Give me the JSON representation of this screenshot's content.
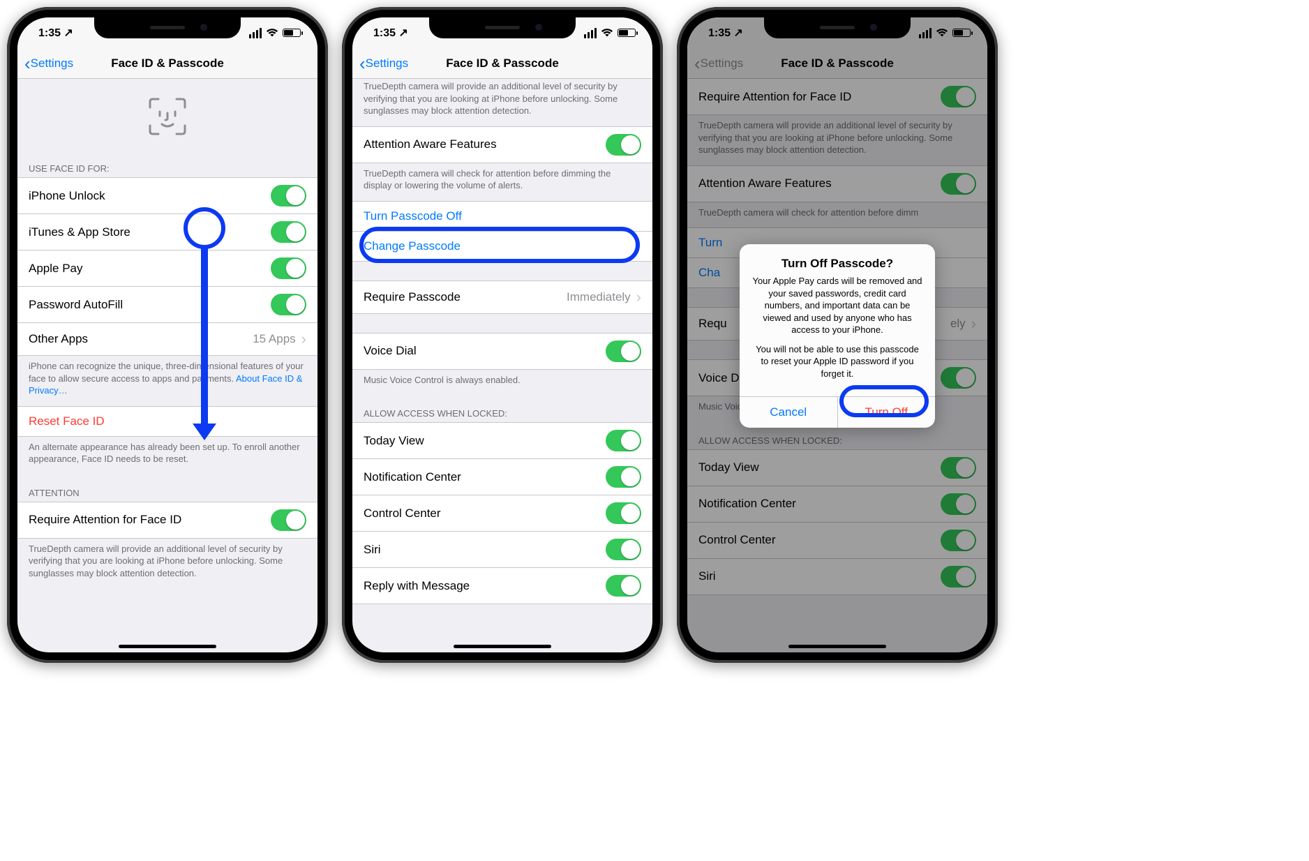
{
  "status": {
    "time": "1:35",
    "loc": "↗"
  },
  "nav": {
    "back": "Settings",
    "title": "Face ID & Passcode"
  },
  "s1": {
    "sectionHeader": "USE FACE ID FOR:",
    "rows": {
      "iphoneUnlock": "iPhone Unlock",
      "itunes": "iTunes & App Store",
      "applePay": "Apple Pay",
      "autofill": "Password AutoFill",
      "otherApps": "Other Apps",
      "otherAppsDetail": "15 Apps"
    },
    "footer1": "iPhone can recognize the unique, three-dimensional features of your face to allow secure access to apps and payments. ",
    "footer1Link": "About Face ID & Privacy…",
    "resetFaceId": "Reset Face ID",
    "footer2": "An alternate appearance has already been set up. To enroll another appearance, Face ID needs to be reset.",
    "attentionHdr": "ATTENTION",
    "reqAttention": "Require Attention for Face ID",
    "footer3": "TrueDepth camera will provide an additional level of security by verifying that you are looking at iPhone before unlocking. Some sunglasses may block attention detection."
  },
  "s2": {
    "truedepthPartial": "TrueDepth camera will provide an additional level of security by verifying that you are looking at iPhone before unlocking. Some sunglasses may block attention detection.",
    "attnAware": "Attention Aware Features",
    "attnFooter": "TrueDepth camera will check for attention before dimming the display or lowering the volume of alerts.",
    "turnOff": "Turn Passcode Off",
    "change": "Change Passcode",
    "reqPass": "Require Passcode",
    "reqPassVal": "Immediately",
    "voiceDial": "Voice Dial",
    "voiceFooter": "Music Voice Control is always enabled.",
    "allowHdr": "ALLOW ACCESS WHEN LOCKED:",
    "today": "Today View",
    "notif": "Notification Center",
    "control": "Control Center",
    "siri": "Siri",
    "reply": "Reply with Message"
  },
  "s3": {
    "reqAttention": "Require Attention for Face ID",
    "truedepthFooter": "TrueDepth camera will provide an additional level of security by verifying that you are looking at iPhone before unlocking. Some sunglasses may block attention detection.",
    "attnAware": "Attention Aware Features",
    "attnFooterPartial": "TrueDepth camera will check for attention before dimm",
    "turnTrunc": "Turn",
    "chaTrunc": "Cha",
    "reqPassTrunc": "Requ",
    "reqPassValTrunc": "ely",
    "voiceDial": "Voice Dial",
    "voiceFooter": "Music Voice Control is always enabled.",
    "allowHdr": "ALLOW ACCESS WHEN LOCKED:",
    "today": "Today View",
    "notif": "Notification Center",
    "control": "Control Center",
    "siri": "Siri"
  },
  "alert": {
    "title": "Turn Off Passcode?",
    "msg1": "Your Apple Pay cards will be removed and your saved passwords, credit card numbers, and important data can be viewed and used by anyone who has access to your iPhone.",
    "msg2": "You will not be able to use this passcode to reset your Apple ID password if you forget it.",
    "cancel": "Cancel",
    "turnOff": "Turn Off"
  }
}
